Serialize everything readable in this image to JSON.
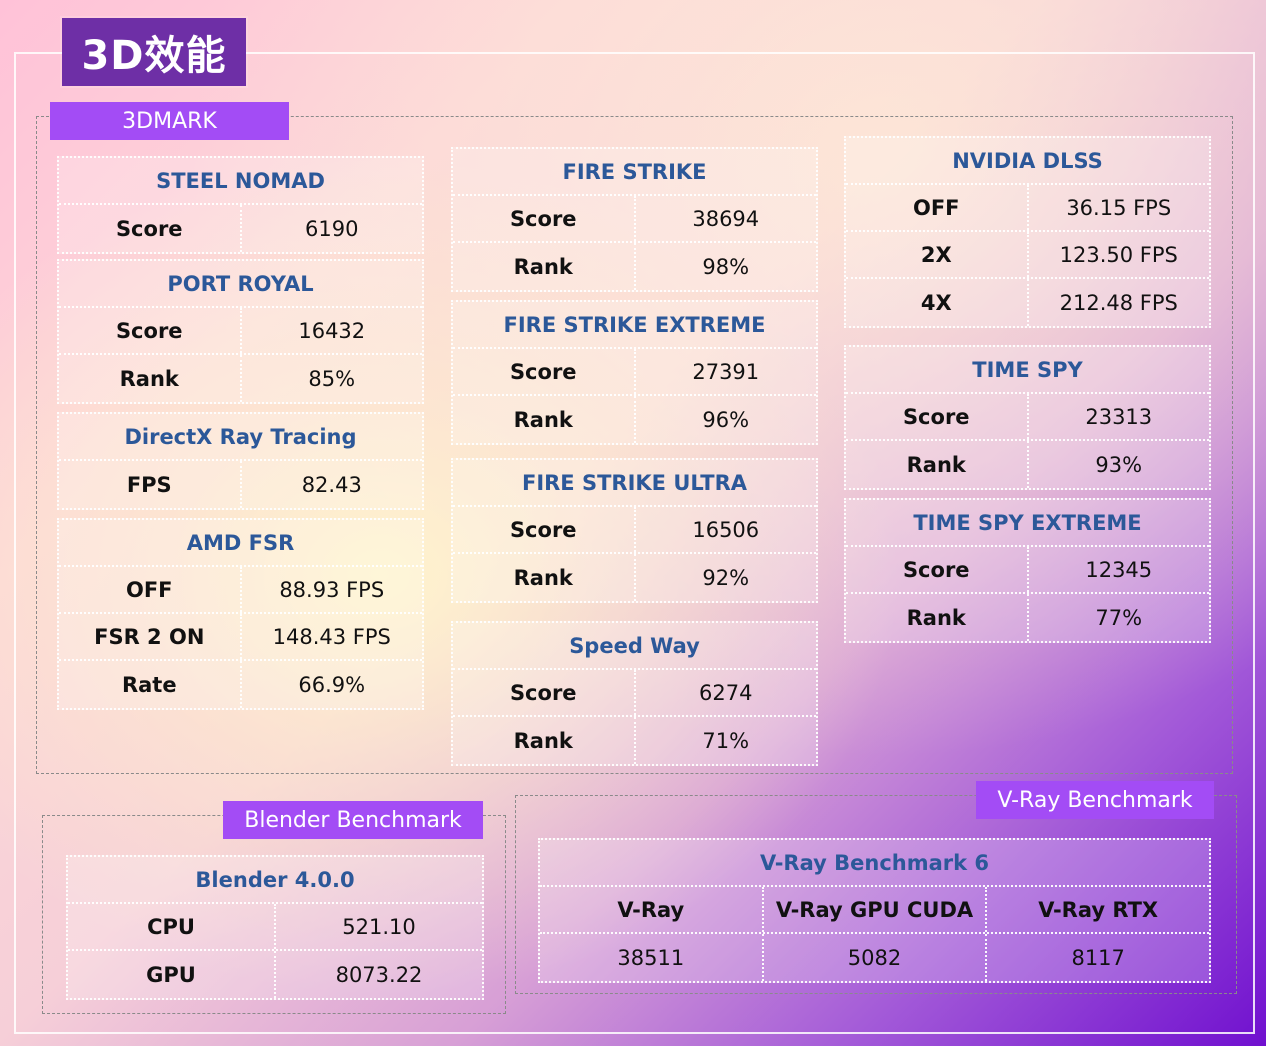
{
  "title": "3D效能",
  "sections": {
    "threedmark": "3DMARK",
    "blender": "Blender Benchmark",
    "vray": "V-Ray Benchmark"
  },
  "steel_nomad": {
    "title": "STEEL NOMAD",
    "rows": [
      {
        "label": "Score",
        "value": "6190"
      }
    ]
  },
  "port_royal": {
    "title": "PORT ROYAL",
    "rows": [
      {
        "label": "Score",
        "value": "16432"
      },
      {
        "label": "Rank",
        "value": "85%"
      }
    ]
  },
  "dxr": {
    "title": "DirectX Ray Tracing",
    "rows": [
      {
        "label": "FPS",
        "value": "82.43"
      }
    ]
  },
  "amd_fsr": {
    "title": "AMD FSR",
    "rows": [
      {
        "label": "OFF",
        "value": "88.93 FPS"
      },
      {
        "label": "FSR 2 ON",
        "value": "148.43 FPS"
      },
      {
        "label": "Rate",
        "value": "66.9%"
      }
    ]
  },
  "fire_strike": {
    "title": "FIRE STRIKE",
    "rows": [
      {
        "label": "Score",
        "value": "38694"
      },
      {
        "label": "Rank",
        "value": "98%"
      }
    ]
  },
  "fire_strike_extreme": {
    "title": "FIRE STRIKE EXTREME",
    "rows": [
      {
        "label": "Score",
        "value": "27391"
      },
      {
        "label": "Rank",
        "value": "96%"
      }
    ]
  },
  "fire_strike_ultra": {
    "title": "FIRE STRIKE ULTRA",
    "rows": [
      {
        "label": "Score",
        "value": "16506"
      },
      {
        "label": "Rank",
        "value": "92%"
      }
    ]
  },
  "speed_way": {
    "title": "Speed Way",
    "rows": [
      {
        "label": "Score",
        "value": "6274"
      },
      {
        "label": "Rank",
        "value": "71%"
      }
    ]
  },
  "nvidia_dlss": {
    "title": "NVIDIA DLSS",
    "rows": [
      {
        "label": "OFF",
        "value": "36.15 FPS"
      },
      {
        "label": "2X",
        "value": "123.50 FPS"
      },
      {
        "label": "4X",
        "value": "212.48 FPS"
      }
    ]
  },
  "time_spy": {
    "title": "TIME SPY",
    "rows": [
      {
        "label": "Score",
        "value": "23313"
      },
      {
        "label": "Rank",
        "value": "93%"
      }
    ]
  },
  "time_spy_extreme": {
    "title": "TIME SPY EXTREME",
    "rows": [
      {
        "label": "Score",
        "value": "12345"
      },
      {
        "label": "Rank",
        "value": "77%"
      }
    ]
  },
  "blender_400": {
    "title": "Blender 4.0.0",
    "rows": [
      {
        "label": "CPU",
        "value": "521.10"
      },
      {
        "label": "GPU",
        "value": "8073.22"
      }
    ]
  },
  "vray6": {
    "title": "V-Ray Benchmark 6",
    "headers": [
      "V-Ray",
      "V-Ray GPU CUDA",
      "V-Ray RTX"
    ],
    "values": [
      "38511",
      "5082",
      "8117"
    ]
  },
  "colors": {
    "accent": "#a34cf5",
    "title_bg": "#6e2fa6",
    "heading_text": "#2c5899"
  }
}
